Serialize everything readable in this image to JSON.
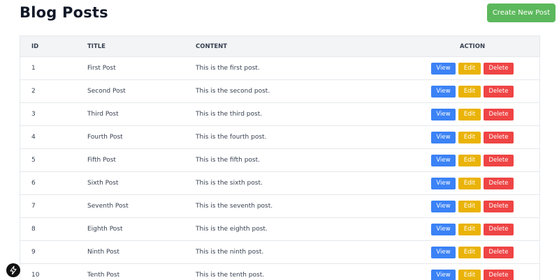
{
  "header": {
    "title": "Blog Posts",
    "create_label": "Create New Post"
  },
  "table": {
    "columns": {
      "id": "ID",
      "title": "TITLE",
      "content": "CONTENT",
      "action": "ACTION"
    },
    "rows": [
      {
        "id": "1",
        "title": "First Post",
        "content": "This is the first post."
      },
      {
        "id": "2",
        "title": "Second Post",
        "content": "This is the second post."
      },
      {
        "id": "3",
        "title": "Third Post",
        "content": "This is the third post."
      },
      {
        "id": "4",
        "title": "Fourth Post",
        "content": "This is the fourth post."
      },
      {
        "id": "5",
        "title": "Fifth Post",
        "content": "This is the fifth post."
      },
      {
        "id": "6",
        "title": "Sixth Post",
        "content": "This is the sixth post."
      },
      {
        "id": "7",
        "title": "Seventh Post",
        "content": "This is the seventh post."
      },
      {
        "id": "8",
        "title": "Eighth Post",
        "content": "This is the eighth post."
      },
      {
        "id": "9",
        "title": "Ninth Post",
        "content": "This is the ninth post."
      },
      {
        "id": "10",
        "title": "Tenth Post",
        "content": "This is the tenth post."
      }
    ]
  },
  "actions": {
    "view": "View",
    "edit": "Edit",
    "delete": "Delete"
  },
  "dev_badge": {
    "icon": "lightning-bolt-icon"
  },
  "colors": {
    "create": "#5cb85c",
    "view": "#3b82f6",
    "edit": "#eab308",
    "delete": "#ef4444",
    "header_bg": "#f3f4f6"
  }
}
